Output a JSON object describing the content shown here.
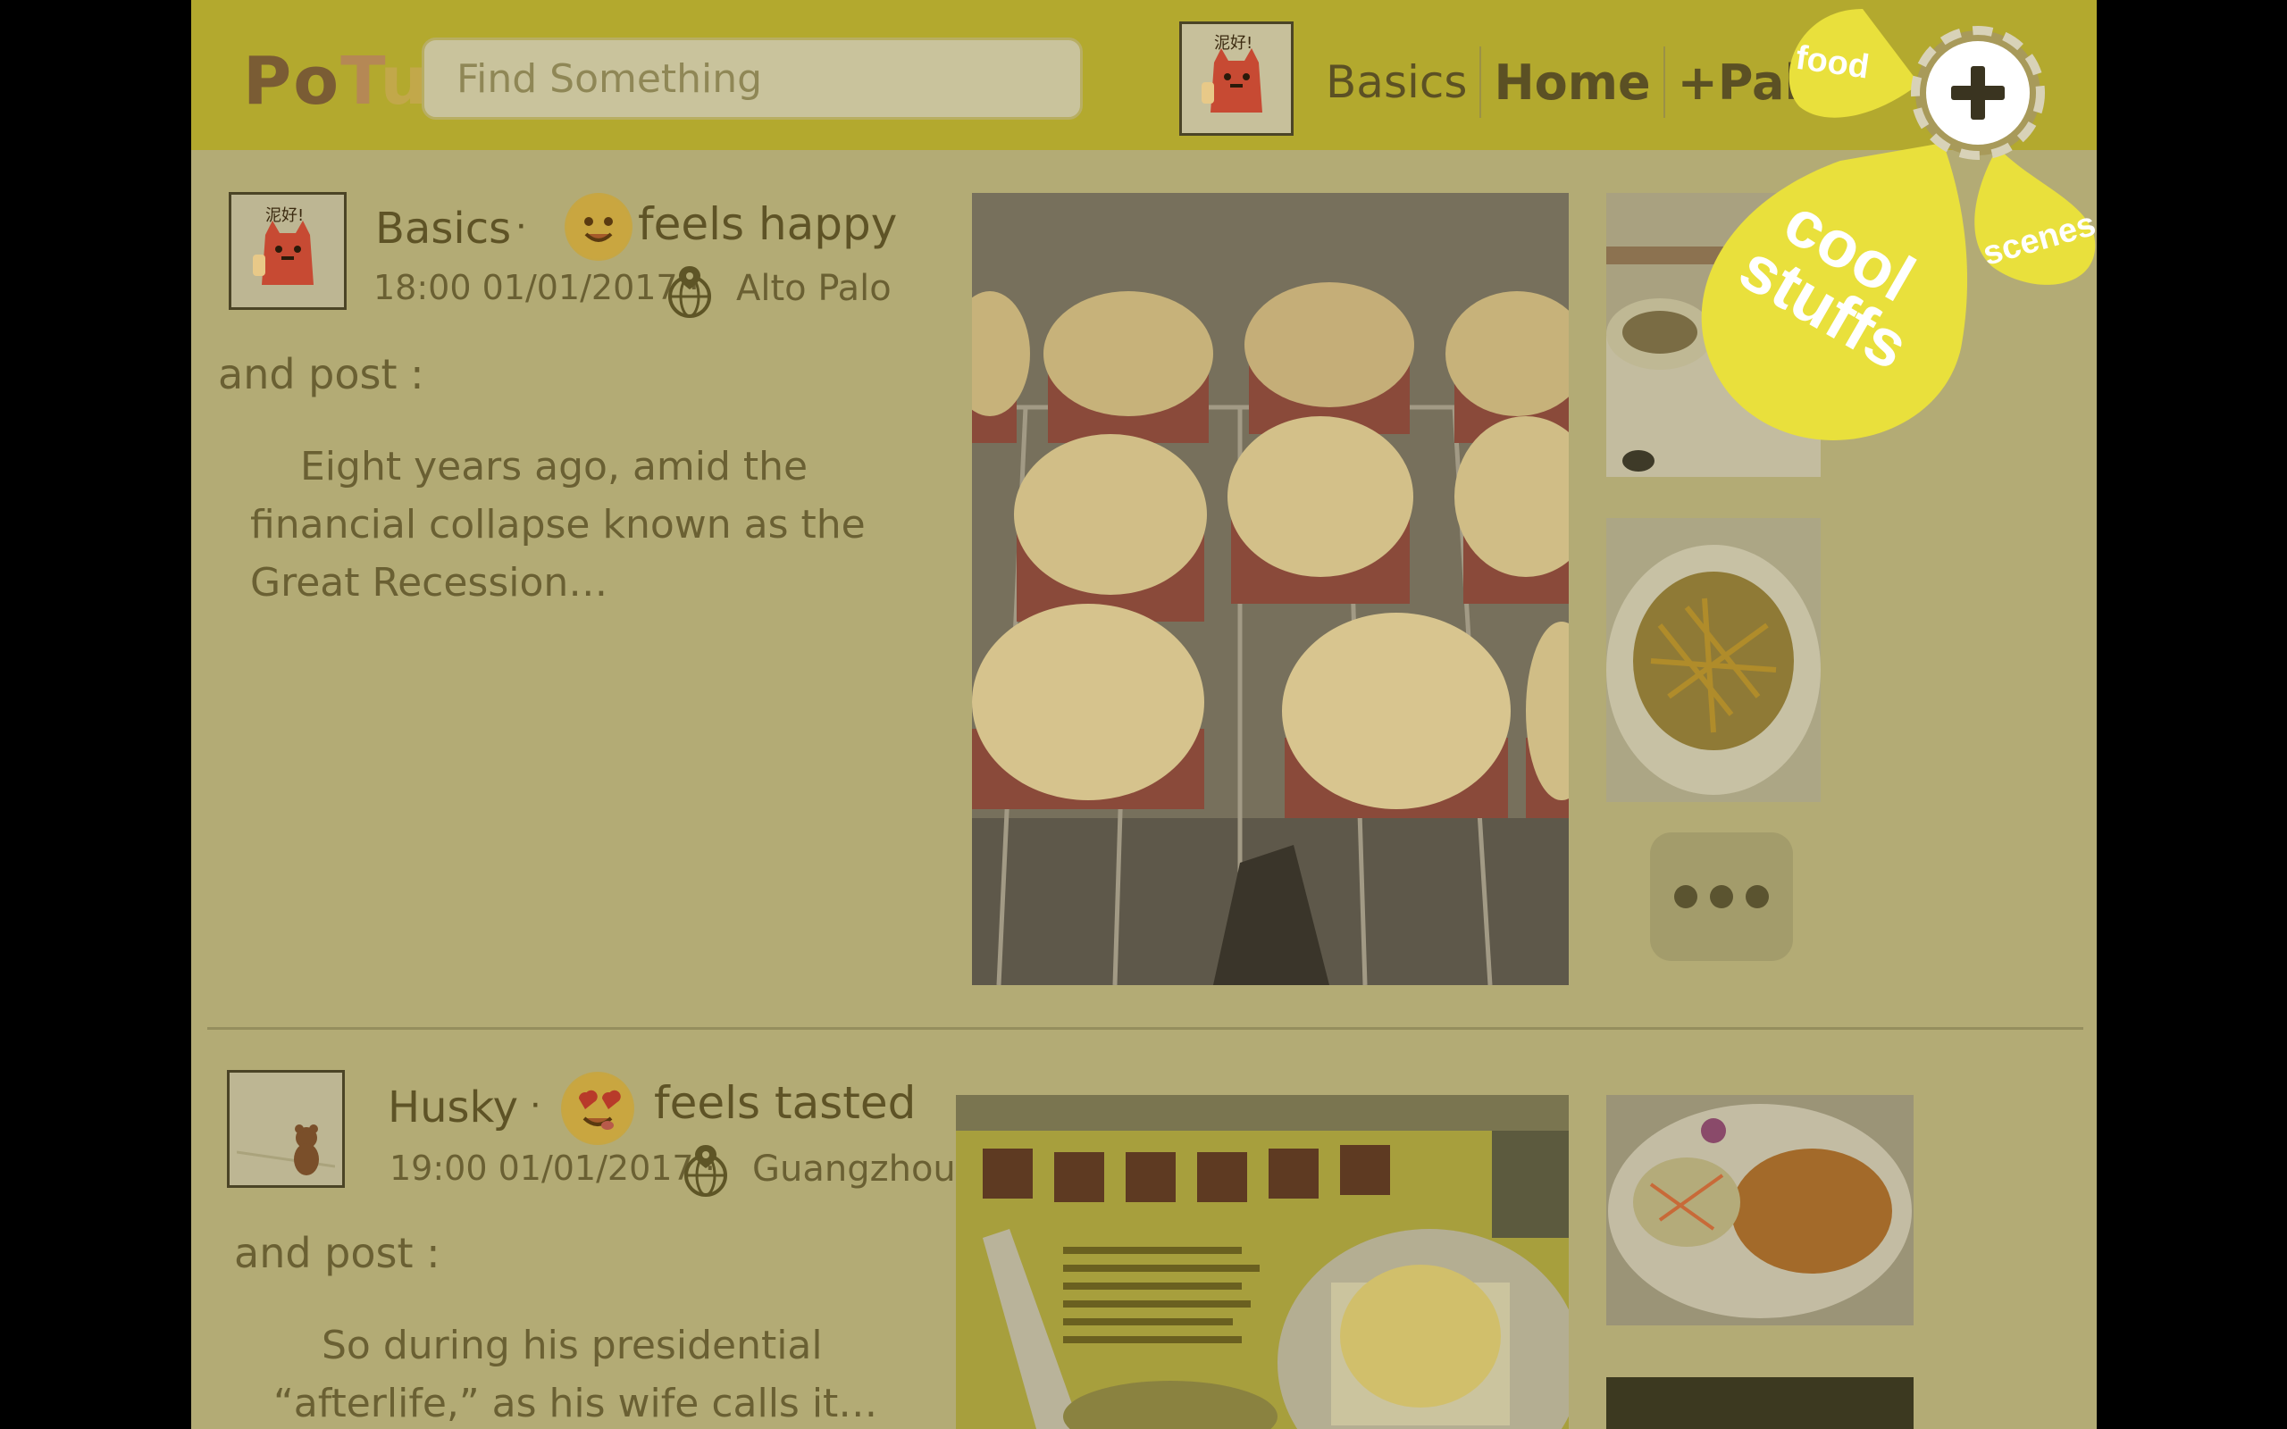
{
  "header": {
    "logo": [
      "Po",
      "T",
      "u"
    ],
    "search_placeholder": "Find Something",
    "nav": {
      "basics": "Basics",
      "home": "Home",
      "pals": "+Pals"
    }
  },
  "posts": [
    {
      "username": "Basics",
      "separator": "·",
      "feeling": "feels happy",
      "time": "18:00 01/01/2017 ·",
      "location": "Alto Palo",
      "and_post": "and post :",
      "body": [
        "Eight years ago, amid the",
        "financial collapse known as the",
        "Great Recession…"
      ]
    },
    {
      "username": "Husky",
      "separator": "·",
      "feeling": "feels tasted",
      "time": "19:00 01/01/2017 ·",
      "location": "Guangzhou",
      "and_post": "and post :",
      "body": [
        "So during his presidential",
        "“afterlife,” as his wife calls it…"
      ]
    }
  ],
  "avatar_text": "泥好!",
  "fab": {
    "food": "food",
    "scenes": "scenes",
    "cool_line1": "cool",
    "cool_line2": "stuffs"
  },
  "colors": {
    "topbar": "#b3a92e",
    "page_bg": "#b3ab75",
    "fab_yellow": "#e9e03c"
  }
}
